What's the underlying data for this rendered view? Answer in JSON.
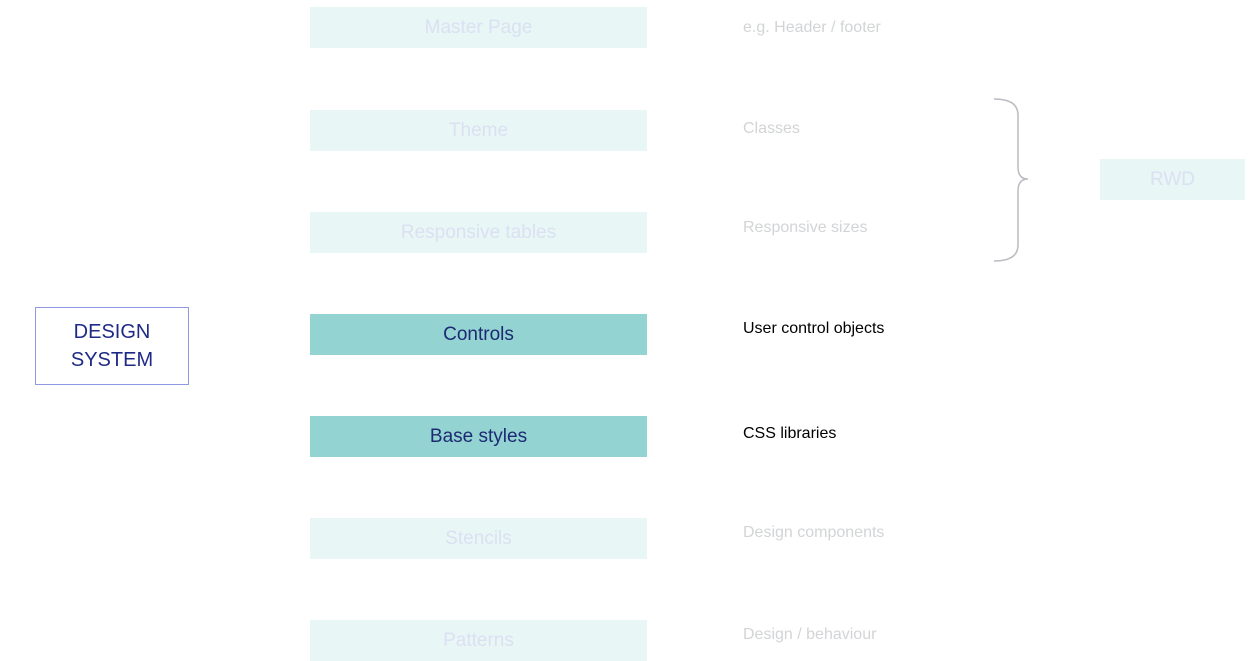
{
  "system": {
    "line1": "DESIGN",
    "line2": "SYSTEM"
  },
  "layers": [
    {
      "label": "Master Page",
      "description": "e.g. Header / footer",
      "state": "dim"
    },
    {
      "label": "Theme",
      "description": "Classes",
      "state": "dim"
    },
    {
      "label": "Responsive tables",
      "description": "Responsive sizes",
      "state": "dim"
    },
    {
      "label": "Controls",
      "description": "User control objects",
      "state": "active"
    },
    {
      "label": "Base styles",
      "description": "CSS libraries",
      "state": "active"
    },
    {
      "label": "Stencils",
      "description": "Design components",
      "state": "dim"
    },
    {
      "label": "Patterns",
      "description": "Design / behaviour",
      "state": "dim"
    }
  ],
  "rwd": {
    "label": "RWD"
  },
  "colors": {
    "active_fill": "#93d3d2",
    "dim_fill": "#e8f6f5",
    "active_text": "#1d2a73",
    "dim_text": "#dbe0f2",
    "system_border": "#8f98e3",
    "system_text": "#1f2a86"
  }
}
